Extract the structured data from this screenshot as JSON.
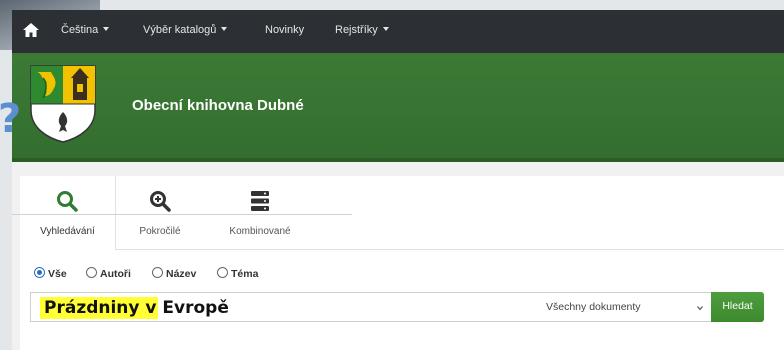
{
  "navbar": {
    "items": [
      {
        "label": "Čeština",
        "dropdown": true
      },
      {
        "label": "Výběr katalogů",
        "dropdown": true
      },
      {
        "label": "Novinky",
        "dropdown": false
      },
      {
        "label": "Rejstříky",
        "dropdown": true
      }
    ]
  },
  "header": {
    "library_name": "Obecní knihovna Dubné"
  },
  "overlay_mark": "?",
  "search": {
    "tabs": [
      {
        "label": "Vyhledávání",
        "icon": "search-icon",
        "active": true
      },
      {
        "label": "Pokročilé",
        "icon": "zoom-in-icon",
        "active": false
      },
      {
        "label": "Kombinované",
        "icon": "server-icon",
        "active": false
      }
    ],
    "scopes": [
      {
        "label": "Vše",
        "checked": true
      },
      {
        "label": "Autoři",
        "checked": false
      },
      {
        "label": "Název",
        "checked": false
      },
      {
        "label": "Téma",
        "checked": false
      }
    ],
    "query": "Prázdniny v Evropě",
    "doc_type": "Všechny dokumenty",
    "button_label": "Hledat"
  },
  "colors": {
    "navbar": "#2c2f33",
    "header_green": "#3d7a36",
    "button_green": "#449435",
    "accent_blue": "#2a6fbf",
    "highlight": "#ffff33"
  }
}
